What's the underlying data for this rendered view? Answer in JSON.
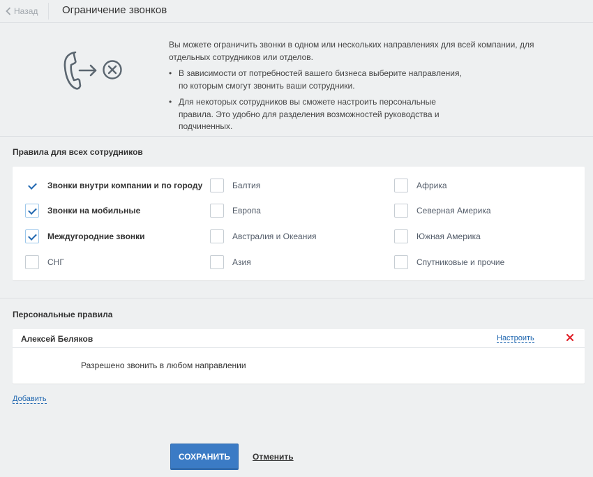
{
  "header": {
    "back_label": "Назад",
    "title": "Ограничение звонков"
  },
  "intro": {
    "lead": "Вы можете ограничить звонки в одном или нескольких направлениях для всей компании, для отдельных сотрудников или отделов.",
    "bullets": [
      "В зависимости от потребностей вашего бизнеса выберите направления, по которым смогут звонить ваши сотрудники.",
      "Для некоторых сотрудников вы сможете настроить персональные правила. Это удобно для разделения возможностей руководства и подчиненных."
    ]
  },
  "rules": {
    "title": "Правила для всех сотрудников",
    "options": [
      {
        "label": "Звонки внутри компании и по городу",
        "checked": true,
        "bold": true,
        "locked": true
      },
      {
        "label": "Звонки на мобильные",
        "checked": true,
        "bold": true
      },
      {
        "label": "Междугородние звонки",
        "checked": true,
        "bold": true
      },
      {
        "label": "СНГ",
        "checked": false
      },
      {
        "label": "Балтия",
        "checked": false
      },
      {
        "label": "Европа",
        "checked": false
      },
      {
        "label": "Австралия и Океания",
        "checked": false
      },
      {
        "label": "Азия",
        "checked": false
      },
      {
        "label": "Африка",
        "checked": false
      },
      {
        "label": "Северная Америка",
        "checked": false
      },
      {
        "label": "Южная Америка",
        "checked": false
      },
      {
        "label": "Спутниковые и прочие",
        "checked": false
      }
    ]
  },
  "personal": {
    "title": "Персональные правила",
    "entries": [
      {
        "name": "Алексей Беляков",
        "configure_label": "Настроить",
        "description": "Разрешено звонить в любом направлении"
      }
    ],
    "add_label": "Добавить"
  },
  "footer": {
    "save_label": "СОХРАНИТЬ",
    "cancel_label": "Отменить"
  },
  "colors": {
    "accent": "#2067b0",
    "save_button": "#3b7bc5",
    "delete": "#e0242c",
    "background": "#eef0f1"
  },
  "icons": {
    "back": "chevron-left-icon",
    "illustration": "phone-arrow-cancel-icon",
    "delete": "close-icon",
    "check": "check-icon"
  }
}
